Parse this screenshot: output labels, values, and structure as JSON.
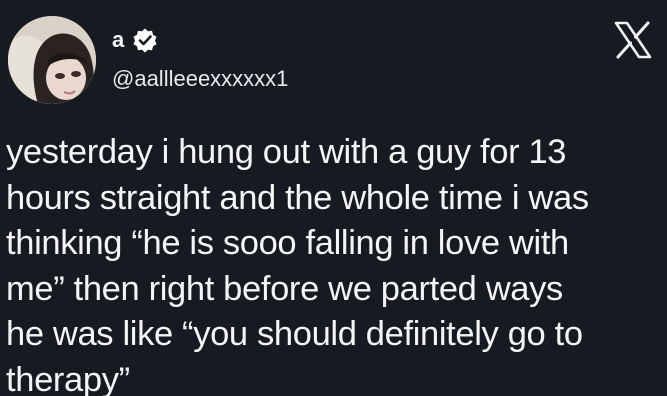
{
  "author": {
    "display_name": "a",
    "handle": "@aallleeexxxxxx1",
    "avatar_icon": "profile-photo",
    "verified_icon": "verified-badge-icon"
  },
  "platform": {
    "logo_icon": "x-logo-icon"
  },
  "tweet": {
    "text": "yesterday i hung out with a guy for 13\nhours straight and the whole time i was\nthinking “he is sooo falling in love with\nme”   then right before we parted ways\nhe was like “you should definitely go to\ntherapy”"
  },
  "colors": {
    "background": "#161b22",
    "text": "#f5f5f5"
  }
}
